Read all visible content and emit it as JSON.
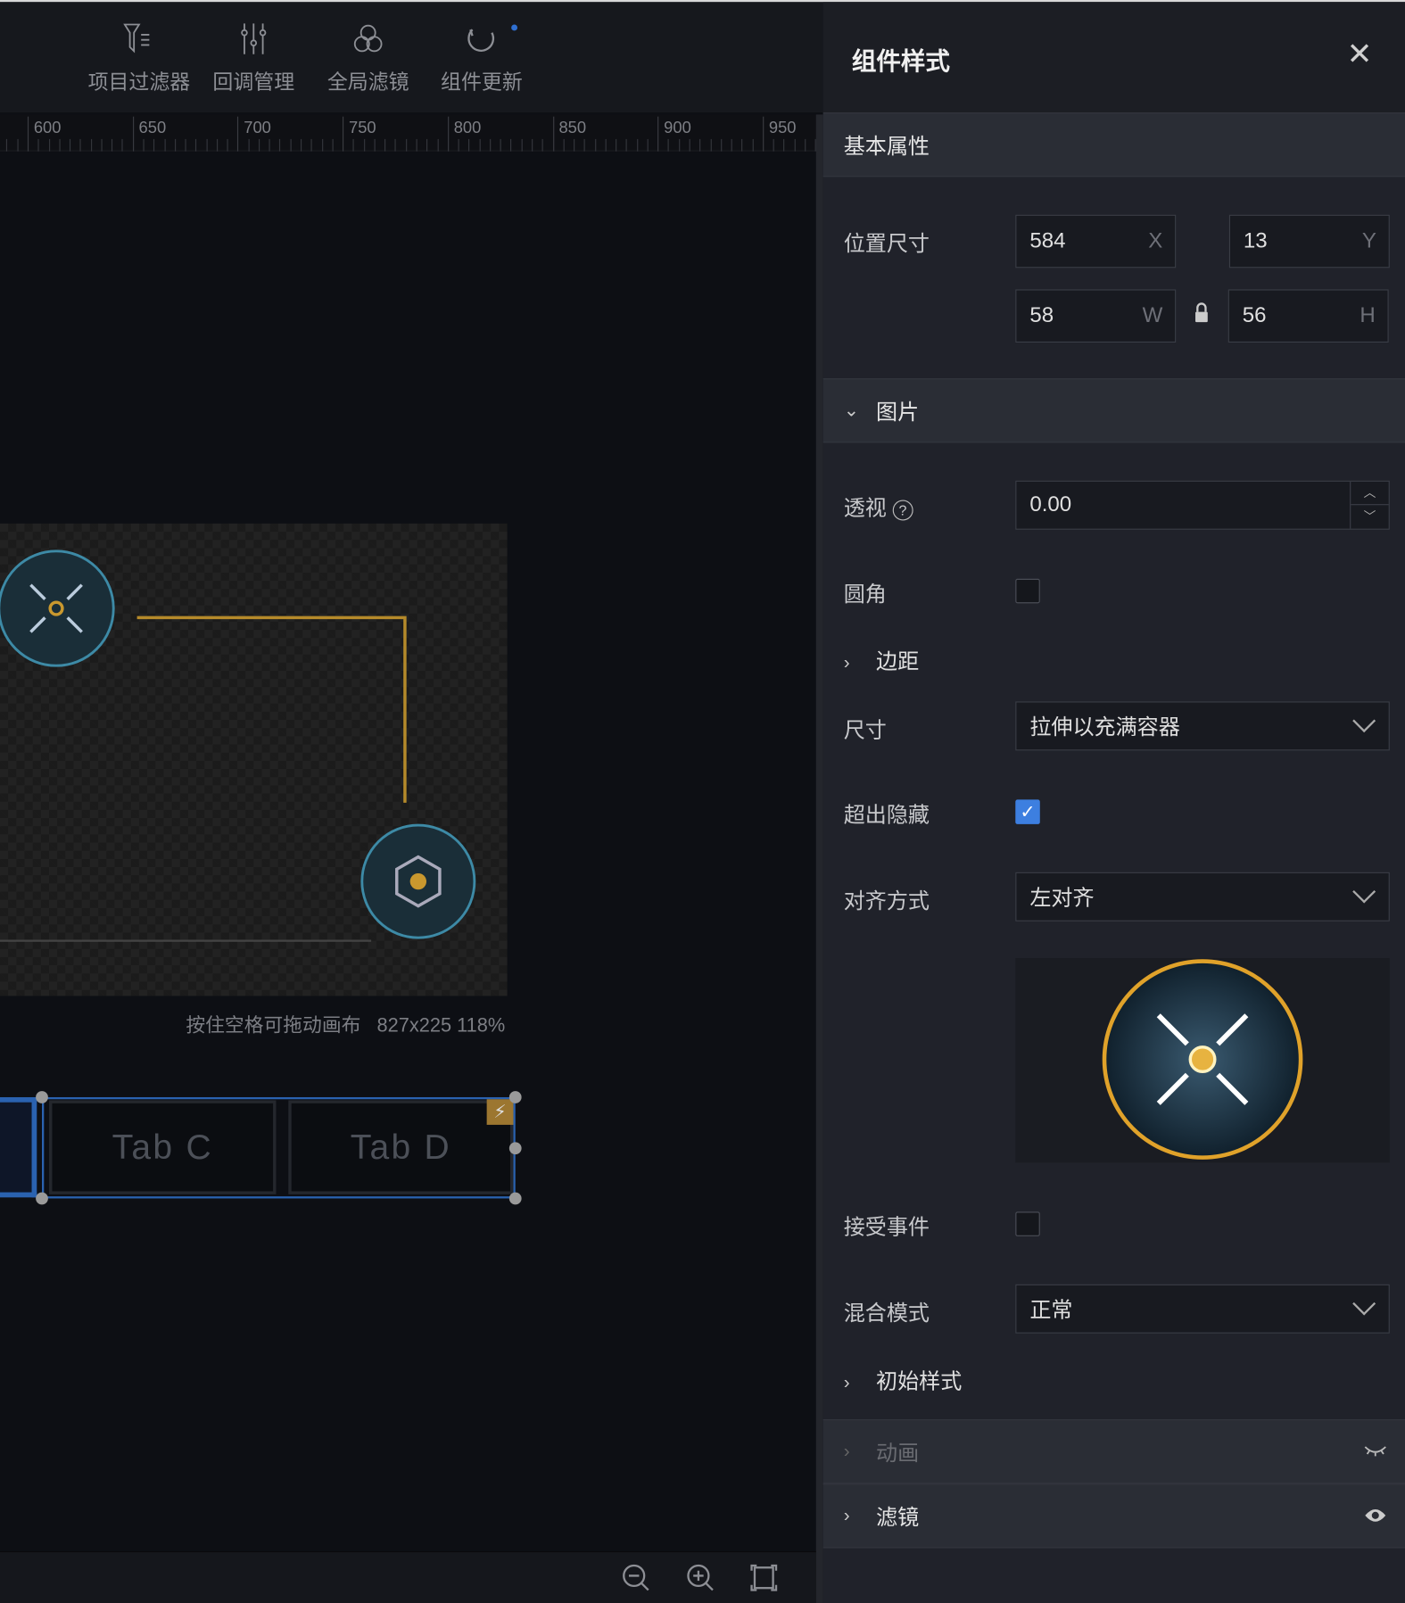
{
  "toolbar": {
    "items": [
      {
        "label": "项目过滤器",
        "icon": "filter-icon"
      },
      {
        "label": "回调管理",
        "icon": "sliders-icon"
      },
      {
        "label": "全局滤镜",
        "icon": "circles-icon"
      },
      {
        "label": "组件更新",
        "icon": "refresh-icon",
        "badge_color": "#2f6fd1"
      }
    ]
  },
  "ruler": {
    "labels": [
      "600",
      "650",
      "700",
      "750",
      "800",
      "850",
      "900",
      "950"
    ]
  },
  "canvas": {
    "hint": "按住空格可拖动画布",
    "size": "827x225",
    "zoom": "118%"
  },
  "tabs": [
    "Tab C",
    "Tab D"
  ],
  "panel": {
    "title": "组件样式",
    "basic_section": "基本属性",
    "position_label": "位置尺寸",
    "x": {
      "value": "584",
      "suffix": "X"
    },
    "y": {
      "value": "13",
      "suffix": "Y"
    },
    "w": {
      "value": "58",
      "suffix": "W"
    },
    "h": {
      "value": "56",
      "suffix": "H"
    },
    "image_section": "图片",
    "perspective_label": "透视",
    "perspective_value": "0.00",
    "radius_label": "圆角",
    "radius_checked": false,
    "margin_label": "边距",
    "size_label": "尺寸",
    "size_value": "拉伸以充满容器",
    "overflow_label": "超出隐藏",
    "overflow_checked": true,
    "align_label": "对齐方式",
    "align_value": "左对齐",
    "events_label": "接受事件",
    "events_checked": false,
    "blend_label": "混合模式",
    "blend_value": "正常",
    "initial_style_label": "初始样式",
    "animation_section": "动画",
    "filter_section": "滤镜"
  },
  "colors": {
    "accent": "#3d7fe0",
    "gold": "#c9982e",
    "selection": "#2a62b0"
  }
}
